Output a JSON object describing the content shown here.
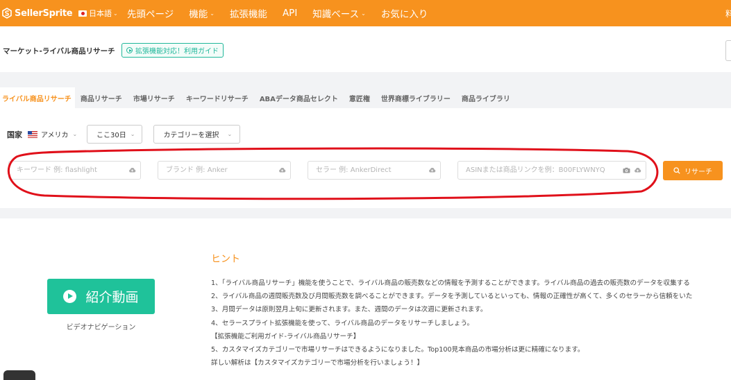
{
  "brand": {
    "logo_text": "SellerSprite"
  },
  "topbar": {
    "language": "日本語",
    "nav": [
      {
        "label": "先頭ページ",
        "dropdown": false
      },
      {
        "label": "機能",
        "dropdown": true
      },
      {
        "label": "拡張機能",
        "dropdown": false
      },
      {
        "label": "API",
        "dropdown": false
      },
      {
        "label": "知識ベース",
        "dropdown": true
      },
      {
        "label": "お気に入り",
        "dropdown": false
      }
    ],
    "right_partial": "料"
  },
  "header": {
    "title": "マーケット-ライバル商品リサーチ",
    "guide_button": "拡張機能対応！利用ガイド"
  },
  "tabs": [
    {
      "label": "ライバル商品リサーチ",
      "active": true
    },
    {
      "label": "商品リサーチ",
      "active": false
    },
    {
      "label": "市場リサーチ",
      "active": false
    },
    {
      "label": "キーワードリサーチ",
      "active": false
    },
    {
      "label": "ABAデータ商品セレクト",
      "active": false
    },
    {
      "label": "意匠権",
      "active": false
    },
    {
      "label": "世界商標ライブラリー",
      "active": false
    },
    {
      "label": "商品ライブラリ",
      "active": false
    }
  ],
  "filters": {
    "country_label": "国家",
    "country_value": "アメリカ",
    "period_value": "ここ30日",
    "category_value": "カテゴリーを選択"
  },
  "search": {
    "keyword_placeholder": "キーワード 例: flashlight",
    "brand_placeholder": "ブランド 例: Anker",
    "seller_placeholder": "セラー 例: AnkerDirect",
    "asin_placeholder": "ASINまたは商品リンクを例：B00FLYWNYQ",
    "button_label": "リサーチ"
  },
  "colors": {
    "accent": "#f7921e",
    "green": "#1fc29a",
    "annotation_red": "#e0101a"
  },
  "video": {
    "button_label": "紹介動画",
    "caption": "ビデオナビゲーション"
  },
  "hints": {
    "title": "ヒント",
    "lines": [
      "1、「ライバル商品リサーチ」機能を使うことで、ライバル商品の販売数などの情報を予測することができます。ライバル商品の過去の販売数のデータを収集する",
      "2、ライバル商品の週間販売数及び月間販売数を調べることができます。データを予測しているといっても、情報の正確性が高くて、多くのセラーから信頼をいた",
      "3、月間データは原則翌月上旬に更新されます。また、週間のデータは次週に更新されます。",
      "4、セラースプライト拡張機能を使って、ライバル商品のデータをリサーチしましょう。",
      "【拡張機能ご利用ガイド-ライバル商品リサーチ】",
      "5、カスタマイズカテゴリーで市場リサーチはできるようになりました。Top100見本商品の市場分析は更に精確になります。",
      "詳しい解析は【カスタマイズカテゴリーで市場分析を行いましょう！】"
    ]
  }
}
